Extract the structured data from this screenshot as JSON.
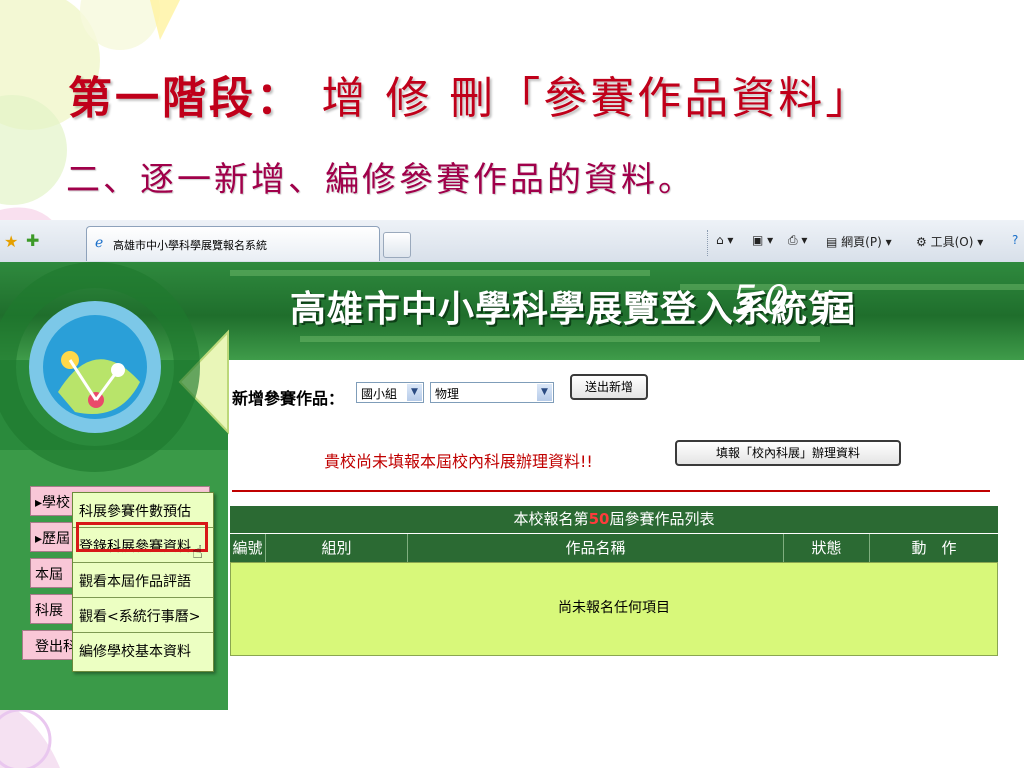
{
  "slide": {
    "title_bold": "第一階段：",
    "title_rest": "增 修 刪「參賽作品資料」",
    "subtitle": "二、逐一新增、編修參賽作品的資料。"
  },
  "browser": {
    "tab_title": "高雄市中小學科學展覽報名系統",
    "toolbar": {
      "page_menu": "網頁(P)",
      "tools_menu": "工具(O)"
    }
  },
  "banner": {
    "title": "高雄市中小學科學展覽登入系統第",
    "number": "50",
    "unit": "屆"
  },
  "form": {
    "label": "新增參賽作品：",
    "group_select": "國小組",
    "subject_select": "物理",
    "submit_label": "送出新增"
  },
  "notice": {
    "text": "貴校尚未填報本屆校內科展辦理資料!!",
    "button_label": "填報「校內科展」辦理資料"
  },
  "sidebar": {
    "items": [
      "▸學校",
      "▸歷屆",
      "本屆",
      "科展",
      "登出科展報名系統"
    ]
  },
  "popup": {
    "items": [
      "科展參賽件數預估",
      "登錄科展參賽資料",
      "觀看本屆作品評語",
      "觀看<系統行事曆>",
      "編修學校基本資料"
    ]
  },
  "table": {
    "caption_prefix": "本校報名第",
    "caption_number": "50",
    "caption_suffix": "屆參賽作品列表",
    "headers": [
      "編號",
      "組別",
      "作品名稱",
      "狀態",
      "動　作"
    ],
    "empty_message": "尚未報名任何項目"
  },
  "colors": {
    "title_red": "#c0001a",
    "subtitle_magenta": "#a0004a",
    "banner_green": "#1f6e2c",
    "table_green": "#2b6a33",
    "table_body": "#d8f87a",
    "highlight_box": "#d81818"
  }
}
